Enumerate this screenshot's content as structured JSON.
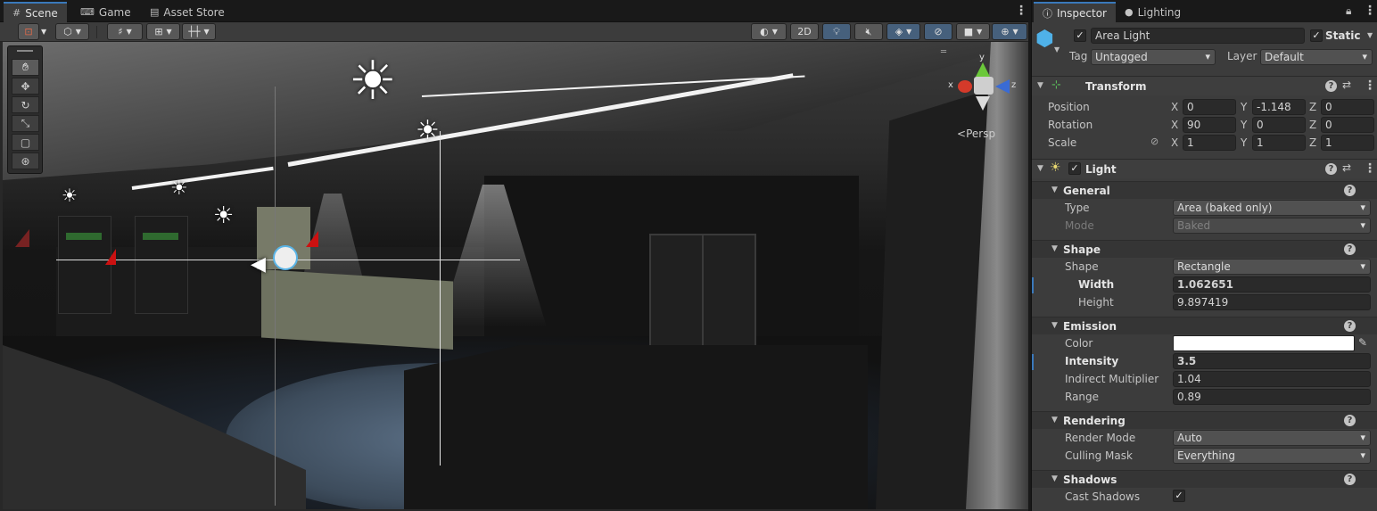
{
  "scene": {
    "tabs": [
      {
        "label": "Scene",
        "icon": "grid-icon"
      },
      {
        "label": "Game",
        "icon": "gamepad-icon"
      },
      {
        "label": "Asset Store",
        "icon": "store-icon"
      }
    ],
    "toolbar": {
      "mode_2d_label": "2D"
    },
    "gizmo": {
      "x_label": "x",
      "y_label": "y",
      "z_label": "z",
      "persp_label": "Persp"
    },
    "tools": [
      "hand-tool",
      "move-tool",
      "rotate-tool",
      "scale-tool",
      "rect-tool",
      "transform-tool"
    ]
  },
  "inspector": {
    "tabs": [
      {
        "label": "Inspector",
        "icon": "info-icon"
      },
      {
        "label": "Lighting",
        "icon": "bulb-icon"
      }
    ],
    "object": {
      "name": "Area Light",
      "active_checked": true,
      "static_label": "Static",
      "static_checked": true,
      "tag_label": "Tag",
      "tag_value": "Untagged",
      "layer_label": "Layer",
      "layer_value": "Default"
    },
    "transform": {
      "title": "Transform",
      "position_label": "Position",
      "rotation_label": "Rotation",
      "scale_label": "Scale",
      "axis_x": "X",
      "axis_y": "Y",
      "axis_z": "Z",
      "position": {
        "x": "0",
        "y": "-1.148",
        "z": "0"
      },
      "rotation": {
        "x": "90",
        "y": "0",
        "z": "0"
      },
      "scale": {
        "x": "1",
        "y": "1",
        "z": "1"
      }
    },
    "light": {
      "title": "Light",
      "enabled": true,
      "general": {
        "title": "General",
        "type_label": "Type",
        "type_value": "Area (baked only)",
        "mode_label": "Mode",
        "mode_value": "Baked"
      },
      "shape": {
        "title": "Shape",
        "shape_label": "Shape",
        "shape_value": "Rectangle",
        "width_label": "Width",
        "width_value": "1.062651",
        "height_label": "Height",
        "height_value": "9.897419"
      },
      "emission": {
        "title": "Emission",
        "color_label": "Color",
        "color_value": "#ffffff",
        "intensity_label": "Intensity",
        "intensity_value": "3.5",
        "indirect_label": "Indirect Multiplier",
        "indirect_value": "1.04",
        "range_label": "Range",
        "range_value": "0.89"
      },
      "rendering": {
        "title": "Rendering",
        "render_mode_label": "Render Mode",
        "render_mode_value": "Auto",
        "culling_label": "Culling Mask",
        "culling_value": "Everything"
      },
      "shadows": {
        "title": "Shadows",
        "cast_label": "Cast Shadows",
        "cast_checked": true
      }
    }
  },
  "colors": {
    "accent": "#3a79bb",
    "panel": "#3c3c3c",
    "tabbar": "#191919"
  }
}
